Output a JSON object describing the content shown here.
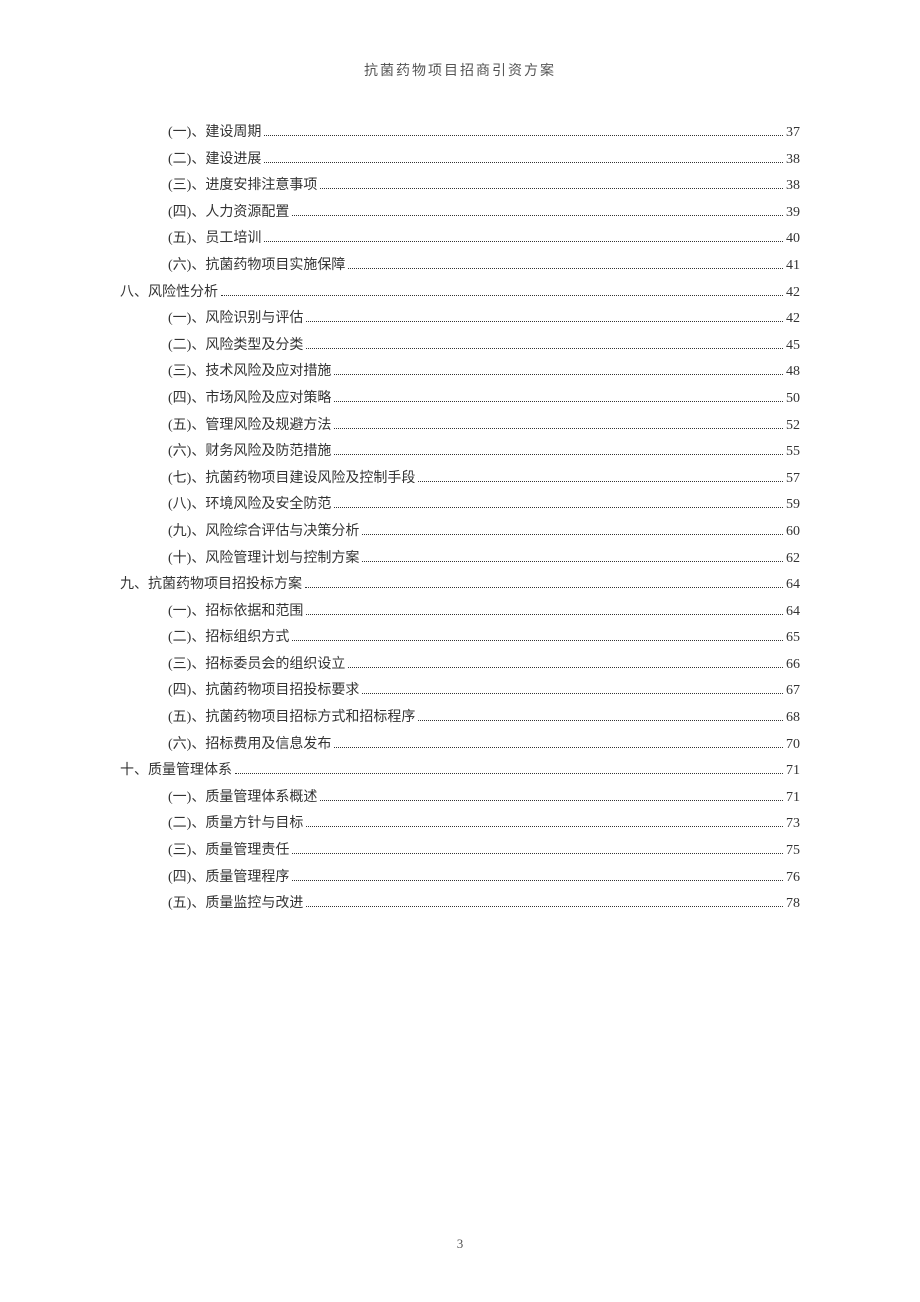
{
  "header_title": "抗菌药物项目招商引资方案",
  "page_number": "3",
  "toc": [
    {
      "level": "sub",
      "label": "(一)、建设周期",
      "page": "37"
    },
    {
      "level": "sub",
      "label": "(二)、建设进展",
      "page": "38"
    },
    {
      "level": "sub",
      "label": "(三)、进度安排注意事项",
      "page": "38"
    },
    {
      "level": "sub",
      "label": "(四)、人力资源配置",
      "page": "39"
    },
    {
      "level": "sub",
      "label": "(五)、员工培训",
      "page": "40"
    },
    {
      "level": "sub",
      "label": "(六)、抗菌药物项目实施保障",
      "page": "41"
    },
    {
      "level": "section",
      "label": "八、风险性分析",
      "page": "42"
    },
    {
      "level": "sub",
      "label": "(一)、风险识别与评估",
      "page": "42"
    },
    {
      "level": "sub",
      "label": "(二)、风险类型及分类",
      "page": "45"
    },
    {
      "level": "sub",
      "label": "(三)、技术风险及应对措施",
      "page": "48"
    },
    {
      "level": "sub",
      "label": "(四)、市场风险及应对策略",
      "page": "50"
    },
    {
      "level": "sub",
      "label": "(五)、管理风险及规避方法",
      "page": "52"
    },
    {
      "level": "sub",
      "label": "(六)、财务风险及防范措施",
      "page": "55"
    },
    {
      "level": "sub",
      "label": "(七)、抗菌药物项目建设风险及控制手段",
      "page": "57"
    },
    {
      "level": "sub",
      "label": "(八)、环境风险及安全防范",
      "page": "59"
    },
    {
      "level": "sub",
      "label": "(九)、风险综合评估与决策分析",
      "page": "60"
    },
    {
      "level": "sub",
      "label": "(十)、风险管理计划与控制方案",
      "page": "62"
    },
    {
      "level": "section",
      "label": "九、抗菌药物项目招投标方案",
      "page": "64"
    },
    {
      "level": "sub",
      "label": "(一)、招标依据和范围",
      "page": "64"
    },
    {
      "level": "sub",
      "label": "(二)、招标组织方式",
      "page": "65"
    },
    {
      "level": "sub",
      "label": "(三)、招标委员会的组织设立",
      "page": "66"
    },
    {
      "level": "sub",
      "label": "(四)、抗菌药物项目招投标要求",
      "page": "67"
    },
    {
      "level": "sub",
      "label": "(五)、抗菌药物项目招标方式和招标程序",
      "page": "68"
    },
    {
      "level": "sub",
      "label": "(六)、招标费用及信息发布",
      "page": "70"
    },
    {
      "level": "section",
      "label": "十、质量管理体系",
      "page": "71"
    },
    {
      "level": "sub",
      "label": "(一)、质量管理体系概述",
      "page": "71"
    },
    {
      "level": "sub",
      "label": "(二)、质量方针与目标",
      "page": "73"
    },
    {
      "level": "sub",
      "label": "(三)、质量管理责任",
      "page": "75"
    },
    {
      "level": "sub",
      "label": "(四)、质量管理程序",
      "page": "76"
    },
    {
      "level": "sub",
      "label": "(五)、质量监控与改进",
      "page": "78"
    }
  ]
}
